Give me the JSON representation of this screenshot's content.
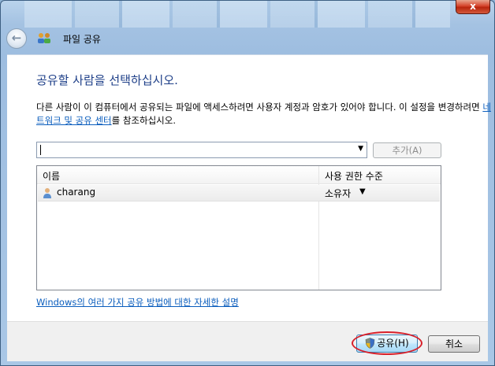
{
  "window": {
    "title": "파일 공유",
    "close_label": "x"
  },
  "main": {
    "heading": "공유할 사람을 선택하십시오.",
    "description_before_link": "다른 사람이 이 컴퓨터에서 공유되는 파일에 액세스하려면 사용자 계정과 암호가 있어야 합니다. 이 설정을 변경하려면 ",
    "description_link": "네트워크 및 공유 센터",
    "description_after_link": "를 참조하십시오.",
    "name_input_value": "",
    "add_button_label": "추가(A)",
    "list": {
      "columns": [
        "이름",
        "사용 권한 수준"
      ],
      "rows": [
        {
          "name": "charang",
          "permission": "소유자"
        }
      ]
    },
    "help_link": "Windows의 여러 가지 공유 방법에 대한 자세한 설명"
  },
  "footer": {
    "share_label": "공유(H)",
    "cancel_label": "취소"
  },
  "icons": {
    "back": "back-arrow-icon",
    "title": "sharing-users-icon",
    "user": "user-icon",
    "shield": "uac-shield-icon"
  },
  "colors": {
    "heading": "#1e3f88",
    "link": "#0a5dbd",
    "highlight": "#d8202a"
  }
}
